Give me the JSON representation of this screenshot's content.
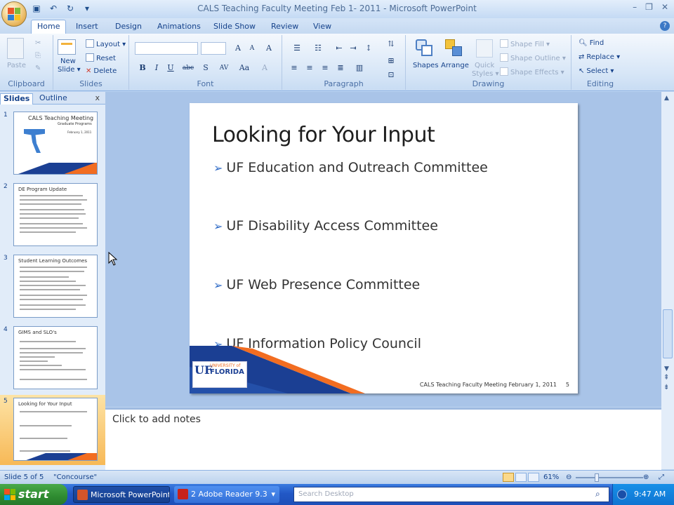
{
  "window": {
    "title": "CALS Teaching Faculty Meeting Feb 1- 2011 - Microsoft PowerPoint",
    "controls": [
      "–",
      "❐",
      "✕"
    ]
  },
  "ribbon_tabs": [
    "Home",
    "Insert",
    "Design",
    "Animations",
    "Slide Show",
    "Review",
    "View"
  ],
  "ribbon": {
    "clipboard": {
      "paste": "Paste",
      "label": "Clipboard"
    },
    "slides": {
      "new_slide": "New\nSlide",
      "new_slide_line1": "New",
      "new_slide_line2": "Slide ▾",
      "layout": "Layout ▾",
      "reset": "Reset",
      "delete": "Delete",
      "label": "Slides"
    },
    "font": {
      "grow": "A",
      "shrink": "A",
      "clear": "A",
      "bold": "B",
      "italic": "I",
      "underline": "U",
      "strike": "abc",
      "shadow": "S",
      "spacing": "AV",
      "case": "Aa",
      "color": "A",
      "label": "Font"
    },
    "paragraph": {
      "label": "Paragraph"
    },
    "drawing": {
      "shapes": "Shapes",
      "arrange": "Arrange",
      "quick_styles": "Quick\nStyles",
      "quick_styles_1": "Quick",
      "quick_styles_2": "Styles ▾",
      "shape_fill": "Shape Fill ▾",
      "shape_outline": "Shape Outline ▾",
      "shape_effects": "Shape Effects ▾",
      "label": "Drawing"
    },
    "editing": {
      "find": "Find",
      "replace": "Replace ▾",
      "select": "Select ▾",
      "label": "Editing"
    }
  },
  "pane": {
    "tabs": [
      "Slides",
      "Outline"
    ],
    "close": "x",
    "thumbnails": [
      {
        "num": "1",
        "title": "CALS Teaching Meeting",
        "sub": "Graduate Programs",
        "date": "February 1, 2011"
      },
      {
        "num": "2",
        "title": "DE Program Update"
      },
      {
        "num": "3",
        "title": "Student Learning Outcomes"
      },
      {
        "num": "4",
        "title": "GIMS and SLO's"
      },
      {
        "num": "5",
        "title": "Looking for Your Input",
        "selected": true
      }
    ]
  },
  "slide": {
    "title": "Looking for Your Input",
    "bullets": [
      "UF Education and Outreach Committee",
      "UF Disability Access Committee",
      "UF Web Presence Committee",
      "UF Information Policy Council"
    ],
    "bullet_glyph": "➢",
    "footer": "CALS Teaching Faculty Meeting February 1, 2011",
    "number": "5",
    "logo": {
      "mark": "UF",
      "line1": "UNIVERSITY of",
      "line2": "FLORIDA"
    }
  },
  "notes": {
    "placeholder": "Click to add notes"
  },
  "status": {
    "slide": "Slide 5 of 5",
    "theme": "\"Concourse\"",
    "zoom": "61%",
    "zoom_fraction": 0.3
  },
  "taskbar": {
    "start": "start",
    "tasks": [
      "Microsoft PowerPoint ...",
      "2 Adobe Reader 9.3"
    ],
    "search_placeholder": "Search Desktop",
    "time": "9:47 AM"
  },
  "colors": {
    "uf_blue": "#1b3f93",
    "uf_orange": "#f26d21",
    "ribbon_bg": "#d7e6f7",
    "bullet_arrow": "#2f6bc6"
  }
}
